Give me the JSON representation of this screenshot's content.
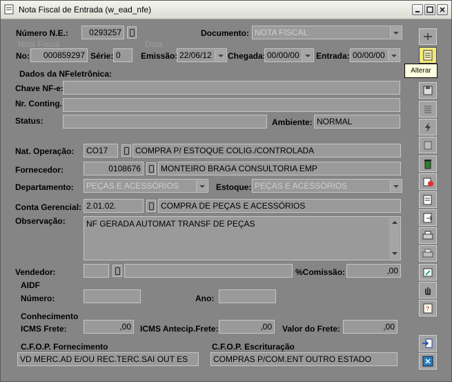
{
  "window": {
    "title": "Nota Fiscal de Entrada (w_ead_nfe)"
  },
  "header": {
    "numero_ne_label": "Número N.E.:",
    "numero_ne_value": "0293257",
    "documento_label": "Documento:",
    "documento_value": "NOTA FISCAL",
    "nota_fiscal_group": "Nota Fiscal",
    "data_group": "Data",
    "no_label": "No:",
    "no_value": "000859297",
    "serie_label": "Série:",
    "serie_value": "0",
    "emissao_label": "Emissão:",
    "emissao_value": "22/06/12",
    "chegada_label": "Chegada:",
    "chegada_value": "00/00/00",
    "entrada_label": "Entrada:",
    "entrada_value": "00/00/00"
  },
  "nfe": {
    "section_label": "Dados da NFeletrônica:",
    "chave_label": "Chave NF-e:",
    "chave_value": "",
    "contig_label": "Nr. Conting.:",
    "contig_value": "",
    "status_label": "Status:",
    "status_value": "",
    "ambiente_label": "Ambiente:",
    "ambiente_value": "NORMAL"
  },
  "details": {
    "nat_op_label": "Nat. Operação:",
    "nat_op_code": "CO17",
    "nat_op_desc": "COMPRA P/ ESTOQUE COLIG./CONTROLADA",
    "fornecedor_label": "Fornecedor:",
    "fornecedor_code": "0108676",
    "fornecedor_name": "MONTEIRO BRAGA CONSULTORIA EMP",
    "departamento_label": "Departamento:",
    "departamento_value": "PEÇAS E ACESSÓRIOS",
    "estoque_label": "Estoque:",
    "estoque_value": "PEÇAS E ACESSÓRIOS",
    "conta_label": "Conta Gerencial:",
    "conta_code": "2.01.02.",
    "conta_desc": "COMPRA DE PEÇAS E ACESSÓRIOS",
    "obs_label": "Observação:",
    "obs_value": "NF GERADA AUTOMAT TRANSF DE PEÇAS",
    "vendedor_label": "Vendedor:",
    "vendedor_code": "",
    "vendedor_name": "",
    "comissao_label": "%Comissão:",
    "comissao_value": ",00"
  },
  "aidf": {
    "section_label": "AIDF",
    "numero_label": "Número:",
    "numero_value": "",
    "ano_label": "Ano:",
    "ano_value": ""
  },
  "conhecimento": {
    "section_label": "Conhecimento",
    "icms_frete_label": "ICMS Frete:",
    "icms_frete_value": ",00",
    "icms_antecip_label": "ICMS Antecip.Frete:",
    "icms_antecip_value": ",00",
    "valor_frete_label": "Valor do Frete:",
    "valor_frete_value": ",00"
  },
  "cfop": {
    "fornecimento_label": "C.F.O.P. Fornecimento",
    "fornecimento_value": "VD MERC.AD E/OU REC.TERC.SAI OUT ES",
    "escrituracao_label": "C.F.O.P. Escrituração",
    "escrituracao_value": "COMPRAS P/COM.ENT OUTRO ESTADO"
  },
  "toolbar": {
    "tooltip": "Alterar",
    "buttons": [
      "insert-icon",
      "edit-icon",
      "save-icon",
      "list-icon",
      "run-icon",
      "copy-icon",
      "delete-icon",
      "cancel-icon",
      "print-preview-icon",
      "export-icon",
      "print-icon",
      "printer-alt-icon",
      "tools-icon",
      "hand-icon",
      "report-icon",
      "import-icon",
      "exit-icon"
    ]
  }
}
